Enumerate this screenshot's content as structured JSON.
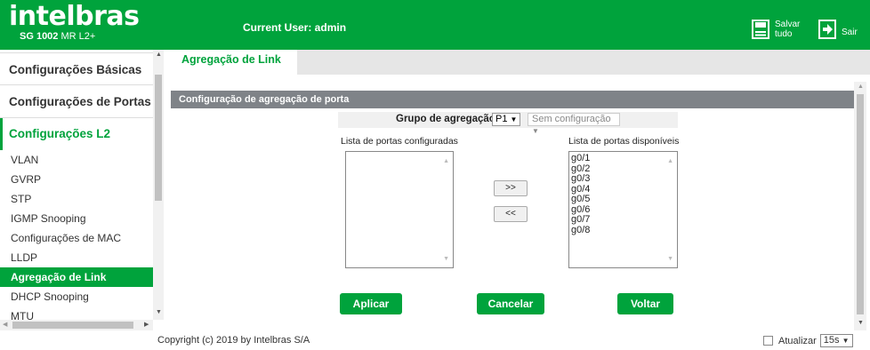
{
  "header": {
    "logo_text": "intelbras",
    "model_bold": "SG 1002",
    "model_rest": " MR L2+",
    "current_user": "Current User: admin",
    "save_label_1": "Salvar",
    "save_label_2": "tudo",
    "exit_label": "Sair",
    "save_icon": "save-disk-icon",
    "exit_icon": "exit-icon"
  },
  "sidebar": {
    "sections": [
      {
        "label": "Configurações Básicas"
      },
      {
        "label": "Configurações de Portas"
      },
      {
        "label": "Configurações L2"
      }
    ],
    "items": [
      {
        "label": "VLAN"
      },
      {
        "label": "GVRP"
      },
      {
        "label": "STP"
      },
      {
        "label": "IGMP Snooping"
      },
      {
        "label": "Configurações de MAC"
      },
      {
        "label": "LLDP"
      },
      {
        "label": "Agregação de Link"
      },
      {
        "label": "DHCP Snooping"
      },
      {
        "label": "MTU"
      }
    ]
  },
  "main": {
    "tab_label": "Agregação de Link",
    "section_title": "Configuração de agregação de porta",
    "group_label": "Grupo de agregação",
    "group_value": "P1",
    "group_status": "Sem configuração",
    "configured_label": "Lista de portas configuradas",
    "available_label": "Lista de portas disponíveis",
    "configured_ports": [],
    "available_ports": [
      "g0/1",
      "g0/2",
      "g0/3",
      "g0/4",
      "g0/5",
      "g0/6",
      "g0/7",
      "g0/8"
    ],
    "add_label": ">>",
    "remove_label": "<<",
    "apply_label": "Aplicar",
    "cancel_label": "Cancelar",
    "back_label": "Voltar"
  },
  "footer": {
    "copyright": "Copyright (c) 2019 by Intelbras S/A",
    "refresh_label": "Atualizar",
    "refresh_value": "15s"
  },
  "colors": {
    "brand_green": "#00a33c",
    "section_gray": "#7f8388"
  }
}
